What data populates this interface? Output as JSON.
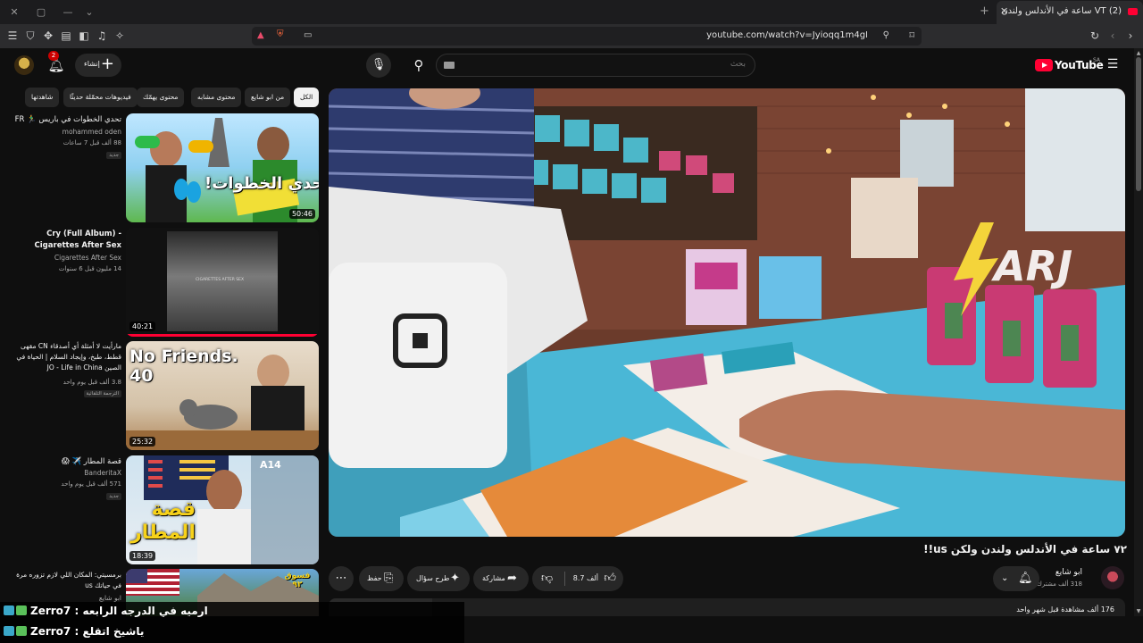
{
  "browser": {
    "tab_title": "VT (2) ساعة في الأندلس ولندن",
    "url": "youtube.com/watch?v=Jyioqq1m4gI"
  },
  "masthead": {
    "logo_text": "YouTube",
    "logo_cc": "SA",
    "search_placeholder": "بحث",
    "create_label": "إنشاء",
    "notif_count": "2"
  },
  "chips": [
    "الكل",
    "من ابو شايع",
    "محتوى مشابه",
    "محتوى يهمّك",
    "فيديوهات محمّلة حديثًا",
    "شاهدتها"
  ],
  "video": {
    "title": "٧٢ ساعة في الأندلس ولندن ولكن us!!",
    "channel_name": "ابو شايع",
    "channel_subs": "318 ألف مشترك",
    "likes": "8.7 ألف",
    "share_label": "مشاركة",
    "ask_label": "طرح سؤال",
    "save_label": "حفظ",
    "views_line": "176 ألف مشاهدة  قبل شهر واحد"
  },
  "recommendations": [
    {
      "title": "تحدي الخطوات في باريس 🏃‍♂️ FR",
      "channel": "mohammed oden",
      "meta": "88 ألف  قبل 7 ساعات",
      "badge": "جديد",
      "duration": "50:46",
      "thumb_text": "تحدي الخطوات!"
    },
    {
      "title": "Cry (Full Album) - Cigarettes After Sex",
      "channel": "Cigarettes After Sex",
      "meta": "14 مليون  قبل 6 سنوات",
      "badge": "",
      "duration": "40:21",
      "thumb_text": "CIGARETTES AFTER SEX"
    },
    {
      "title": "مارأيت لا أمثلة أي أصدقاء CN مقهى قطط، طبخ، وإيجاد السلام | الحياة في الصين JO - Life in China",
      "channel": "",
      "meta": "3.8 ألف  قبل يوم واحد",
      "badge": "الترجمة التلقائية",
      "duration": "25:32",
      "thumb_text": "No Friends. 40"
    },
    {
      "title": "قصة المطار ✈️ 😱",
      "channel": "BanderitaX",
      "meta": "571 ألف  قبل يوم واحد",
      "badge": "جديد",
      "duration": "18:39",
      "thumb_text": "قصة المطار"
    },
    {
      "title": "برمسيتي: المكان اللي لازم تزوره مرة في حياتك us",
      "channel": "ابو شايع",
      "meta": "",
      "badge": "",
      "duration": "",
      "thumb_text": "فسوق ٩٢"
    }
  ],
  "chat": [
    {
      "user": "Zerro7",
      "message": "ارميه في الدرجه الرابعه"
    },
    {
      "user": "Zerro7",
      "message": "ياشيخ اتقلع"
    }
  ],
  "colors": {
    "brand": "#ff0033",
    "background": "#0f0f0f",
    "chip": "#272727"
  }
}
